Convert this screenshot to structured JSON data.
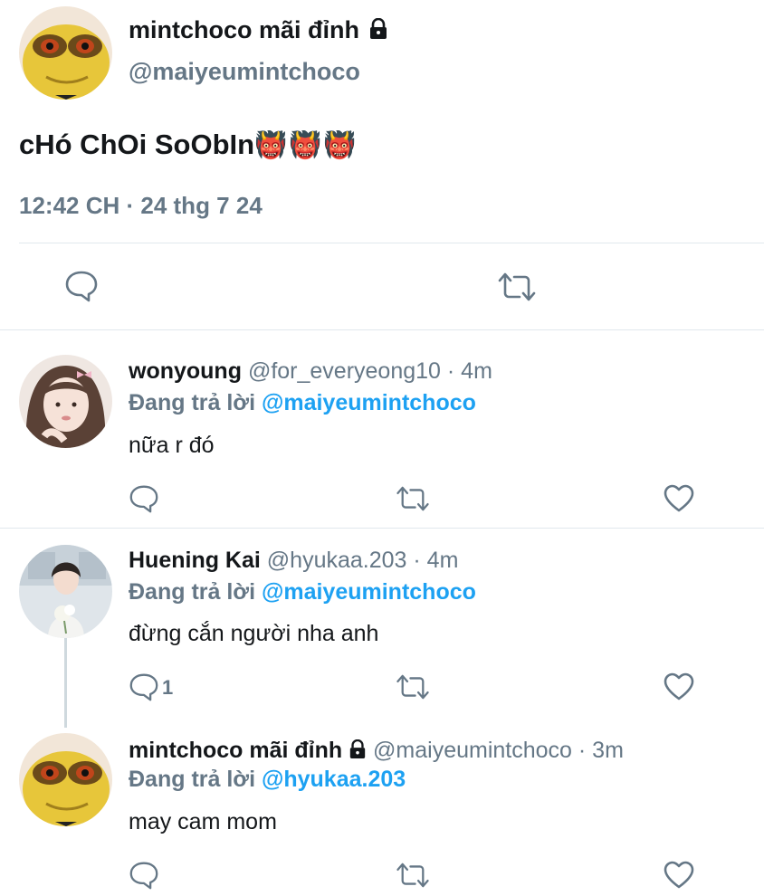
{
  "main_tweet": {
    "display_name": "mintchoco mãi đỉnh",
    "handle": "@maiyeumintchoco",
    "text": "cHó ChOi SoObIn",
    "text_emojis": "👹👹👹",
    "timestamp": "12:42 CH · 24 thg 7 24"
  },
  "replies": [
    {
      "display_name": "wonyoung",
      "handle": "@for_everyeong10",
      "time": "· 4m",
      "replying_label": "Đang trả lời",
      "replying_to": "@maiyeumintchoco",
      "text": "nữa r đó",
      "reply_count": ""
    },
    {
      "display_name": "Huening Kai",
      "handle": "@hyukaa.203",
      "time": "· 4m",
      "replying_label": "Đang trả lời",
      "replying_to": "@maiyeumintchoco",
      "text": "đừng cắn người nha anh",
      "reply_count": "1"
    },
    {
      "display_name": "mintchoco mãi đỉnh",
      "handle": "@maiyeumintchoco",
      "time": "· 3m",
      "replying_label": "Đang trả lời",
      "replying_to": "@hyukaa.203",
      "text": "may cam mom",
      "reply_count": ""
    }
  ],
  "icons": [
    "lock-icon",
    "reply-icon",
    "retweet-icon",
    "like-icon"
  ],
  "colors": {
    "link": "#1da1f2",
    "muted": "#657786",
    "text": "#14171a",
    "divider": "#e1e8ed"
  }
}
